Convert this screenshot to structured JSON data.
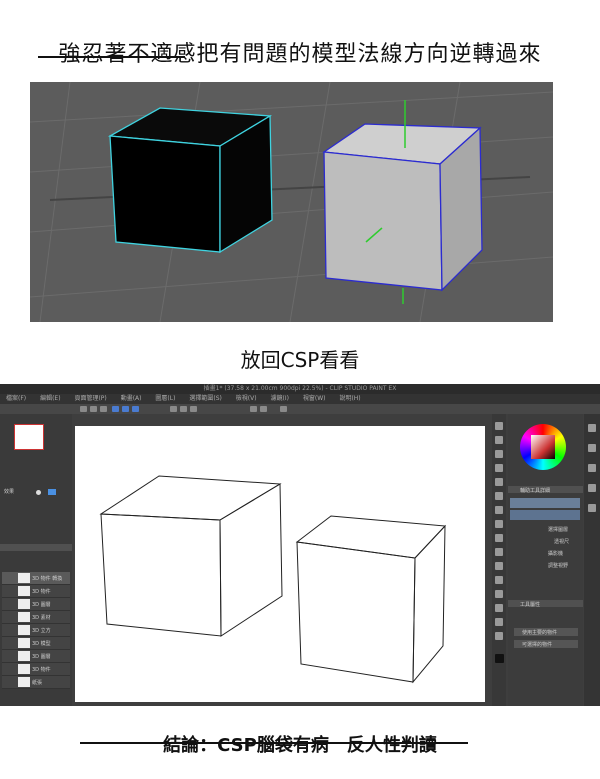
{
  "captions": {
    "top": "強忍著不適感把有問題的模型法線方向逆轉過來",
    "middle": "放回CSP看看",
    "bottom": "結論：CSP腦袋有病　反人性判讀"
  },
  "csp": {
    "title": "插畫1* (37.58 x 21.00cm 900dpi 22.5%) - CLIP STUDIO PAINT EX",
    "menu": [
      "檔案(F)",
      "編輯(E)",
      "頁面管理(P)",
      "動畫(A)",
      "圖層(L)",
      "選擇範圍(S)",
      "檢視(V)",
      "濾鏡(I)",
      "視窗(W)",
      "說明(H)"
    ],
    "left_panel_label": "效果",
    "layers": [
      "3D 物件 轉換",
      "3D 物件",
      "3D 圖層",
      "3D 素材",
      "3D 立方",
      "3D 模型",
      "3D 圖層",
      "3D 物件",
      "紙張"
    ],
    "right_panel": {
      "tab1": "輔助工具詳細",
      "tab2": "工具屬性",
      "items": [
        "選擇圖層",
        "透視尺",
        "攝影機",
        "調整視野"
      ],
      "dropdown1": "使用主要的物件",
      "dropdown2": "可選擇的物件"
    }
  },
  "colors": {
    "viewport_bg": "#5c5c5c",
    "cube_black_outline": "#3fd3e0",
    "cube_white_outline": "#2b2bd0",
    "cube_white_fill": "#bdbdbd",
    "axis_green": "#2ecc2e"
  }
}
